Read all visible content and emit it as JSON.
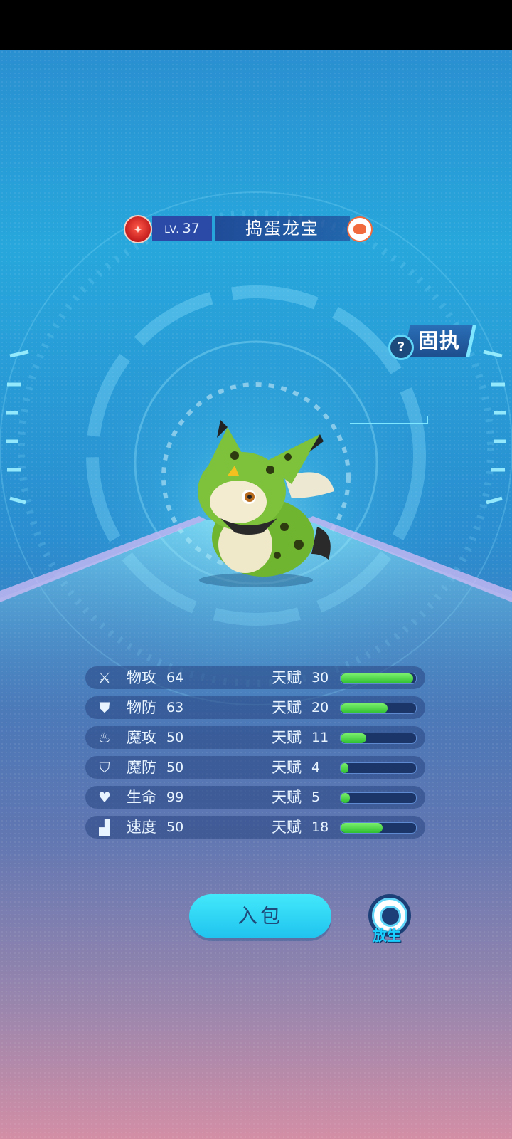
{
  "pet": {
    "level_prefix": "LV.",
    "level": "37",
    "name": "捣蛋龙宝",
    "nature": "固执",
    "nature_help": "?"
  },
  "stats": [
    {
      "icon": "sword-icon",
      "label": "物攻",
      "value": "64",
      "talent_label": "天赋",
      "talent": "30",
      "talent_fraction": 0.96
    },
    {
      "icon": "shield-icon",
      "label": "物防",
      "value": "63",
      "talent_label": "天赋",
      "talent": "20",
      "talent_fraction": 0.62
    },
    {
      "icon": "flame-icon",
      "label": "魔攻",
      "value": "50",
      "talent_label": "天赋",
      "talent": "11",
      "talent_fraction": 0.34
    },
    {
      "icon": "magic-shield-icon",
      "label": "魔防",
      "value": "50",
      "talent_label": "天赋",
      "talent": "4",
      "talent_fraction": 0.1
    },
    {
      "icon": "heart-plus-icon",
      "label": "生命",
      "value": "99",
      "talent_label": "天赋",
      "talent": "5",
      "talent_fraction": 0.12
    },
    {
      "icon": "boot-icon",
      "label": "速度",
      "value": "50",
      "talent_label": "天赋",
      "talent": "18",
      "talent_fraction": 0.56
    }
  ],
  "actions": {
    "bag_label": "入包",
    "release_label": "放生"
  },
  "colors": {
    "bar_fill": "#3fd23a",
    "bag_button": "#2fd3f2",
    "release_text": "#1ad0ff"
  }
}
